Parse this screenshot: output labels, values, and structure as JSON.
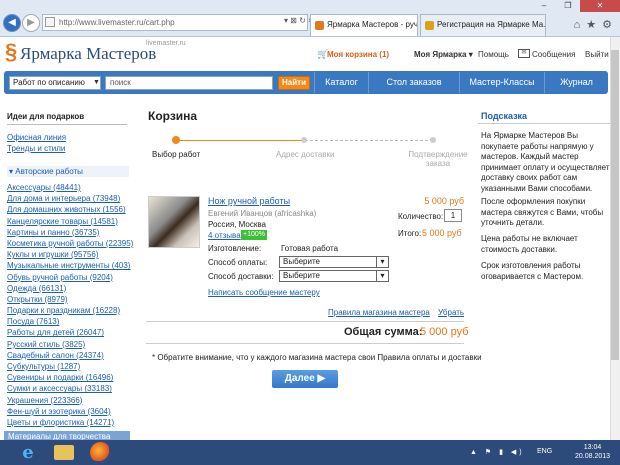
{
  "browser": {
    "url": "http://www.livemaster.ru/cart.php",
    "tabs": [
      {
        "label": "Ярмарка Мастеров - ручн..."
      },
      {
        "label": "Регистрация на Ярмарке Ма..."
      }
    ],
    "addr_tools": "▾ ⊠ ↻ ×",
    "window_controls": {
      "min": "–",
      "max": "❐",
      "close": "✕"
    },
    "tools_icons": "⌂★⚙"
  },
  "header": {
    "logo": "Ярмарка Мастеров",
    "logo_sub": "livemaster.ru",
    "cart": "Моя корзина (1)",
    "my_fair": "Моя Ярмарка ▾",
    "help": "Помощь",
    "messages": "Сообщения",
    "logout": "Выйти"
  },
  "search": {
    "select_value": "Работ по описанию",
    "placeholder": "поиск",
    "button": "Найти",
    "nav": [
      "Каталог",
      "Стол заказов",
      "Мастер-Классы",
      "Журнал"
    ]
  },
  "sidebar": {
    "ideas_title": "Идеи для подарков",
    "links": [
      "Офисная линия",
      "Тренды и стили"
    ],
    "authors_header": "▾ Авторские работы",
    "categories": [
      "Аксессуары (48441)",
      "Для дома и интерьера (73948)",
      "Для домашних животных (1556)",
      "Канцелярские товары (14581)",
      "Картины и панно (36735)",
      "Косметика ручной работы (22395)",
      "Куклы и игрушки (95756)",
      "Музыкальные инструменты (403)",
      "Обувь ручной работы (9204)",
      "Одежда (66131)",
      "Открытки (8979)",
      "Подарки к праздникам (16228)",
      "Посуда (7613)",
      "Работы для детей (26047)",
      "Русский стиль (3825)",
      "Свадебный салон (24374)",
      "Субкультуры (1287)",
      "Сувениры и подарки (16496)",
      "Сумки и аксессуары (33183)",
      "Украшения (223366)",
      "Фен-шуй и эзотерика (3604)",
      "Цветы и флористика (14271)"
    ],
    "bottom_header": "Материалы для творчества"
  },
  "cart": {
    "title": "Корзина",
    "steps": [
      "Выбор работ",
      "Адрес доставки",
      "Подтверждение заказа"
    ],
    "item": {
      "name": "Нож ручной работы",
      "master": "Евгений Иванцов (africashka)",
      "location": "Россия, Москва",
      "reviews": "4 отзыва",
      "rating": "+100%",
      "price": "5 000 руб",
      "qty_label": "Количество:",
      "qty": "1",
      "total_label": "Итого:",
      "total": "5 000 руб",
      "mfg_label": "Изготовление:",
      "mfg_value": "Готовая работа",
      "payment_label": "Способ оплаты:",
      "payment_value": "Выберите",
      "delivery_label": "Способ доставки:",
      "delivery_value": "Выберите",
      "write_message": "Написать сообщение мастеру"
    },
    "rules_link": "Правила магазина мастера",
    "remove_link": "Убрать",
    "sum_label": "Общая сумма:",
    "sum_value": "5 000 руб",
    "note": "* Обратите внимание, что у каждого магазина мастера свои Правила оплаты и доставки",
    "next_button": "Далее ▶"
  },
  "hint": {
    "title": "Подсказка",
    "paragraphs": [
      "На Ярмарке Мастеров Вы покупаете работы напрямую у мастеров. Каждый мастер принимает оплату и осуществляет доставку своих работ сам указанными Вами способами.",
      "После оформления покупки мастера свяжутся с Вами, чтобы уточнить детали.",
      "Цена работы не включает стоимость доставки.",
      "Срок изготовления работы оговаривается с Мастером."
    ]
  },
  "taskbar": {
    "ie_glyph": "e",
    "tray": "▲ ⚑ ▮ ◀)",
    "lang": "ENG",
    "time": "13:04",
    "date": "20.08.2013"
  }
}
